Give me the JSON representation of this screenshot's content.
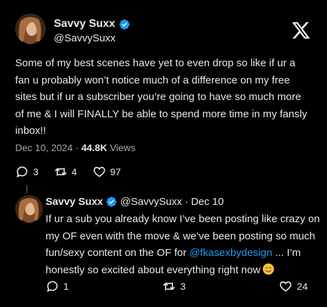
{
  "top_tweet": {
    "display_name": "Savvy Suxx",
    "handle": "@SavvySuxx",
    "body": "Some of my best scenes have yet to even drop so like if ur a fan u probably won’t notice much of a difference on my free sites but if ur a subscriber you’re going to have so much more of me & I will FINALLY be able to spend more time in my fansly inbox!!",
    "date": "Dec 10, 2024",
    "separator": "·",
    "views_count": "44.8K",
    "views_label": "Views",
    "replies": "3",
    "retweets": "4",
    "likes": "97"
  },
  "reply_tweet": {
    "display_name": "Savvy Suxx",
    "handle": "@SavvySuxx",
    "separator": "·",
    "date": "Dec 10",
    "body_before": "If ur a sub you already know I’ve been posting like crazy on my OF even with the move & we’ve been posting so much fun/sexy content on the OF for ",
    "mention": "@fkasexbydesign",
    "body_after": " ... I’m honestly so excited about everything right now",
    "replies": "1",
    "retweets": "3",
    "likes": "24"
  },
  "icons": {
    "verified": "verified-badge-icon",
    "x_logo": "x-logo-icon",
    "reply": "reply-bubble-icon",
    "retweet": "retweet-icon",
    "like": "heart-icon",
    "emoji": "smiling-face-emoji"
  },
  "colors": {
    "background": "#000000",
    "text": "#e7e9ea",
    "muted": "#a6a9ad",
    "accent": "#1d9bf0"
  }
}
